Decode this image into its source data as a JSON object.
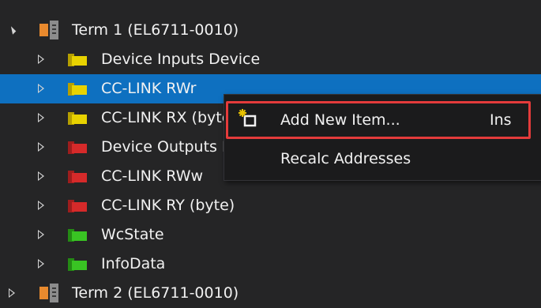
{
  "tree": {
    "items": [
      {
        "label": "Term 1 (EL6711-0010)",
        "icon": "terminal-icon",
        "expanded": true
      },
      {
        "label": "Device Inputs Device",
        "icon": "folder-yellow-icon"
      },
      {
        "label": "CC-LINK RWr",
        "icon": "folder-yellow-icon",
        "selected": true
      },
      {
        "label": "CC-LINK RX (byte)",
        "icon": "folder-yellow-icon"
      },
      {
        "label": "Device Outputs Device",
        "icon": "folder-red-icon"
      },
      {
        "label": "CC-LINK RWw",
        "icon": "folder-red-icon"
      },
      {
        "label": "CC-LINK RY (byte)",
        "icon": "folder-red-icon"
      },
      {
        "label": "WcState",
        "icon": "folder-green-icon"
      },
      {
        "label": "InfoData",
        "icon": "folder-green-icon"
      },
      {
        "label": "Term 2 (EL6711-0010)",
        "icon": "terminal-icon"
      }
    ]
  },
  "context_menu": {
    "items": [
      {
        "label": "Add New Item...",
        "shortcut": "Ins",
        "icon": "add-new-item-icon",
        "highlighted": true
      },
      {
        "label": "Recalc Addresses",
        "shortcut": ""
      }
    ]
  },
  "colors": {
    "background": "#252526",
    "selection": "#0e70c0",
    "highlight_border": "#e43b3b",
    "folder_yellow": "#e8d200",
    "folder_red": "#d62a2a",
    "folder_green": "#39c423",
    "terminal_orange": "#e98a2e"
  }
}
